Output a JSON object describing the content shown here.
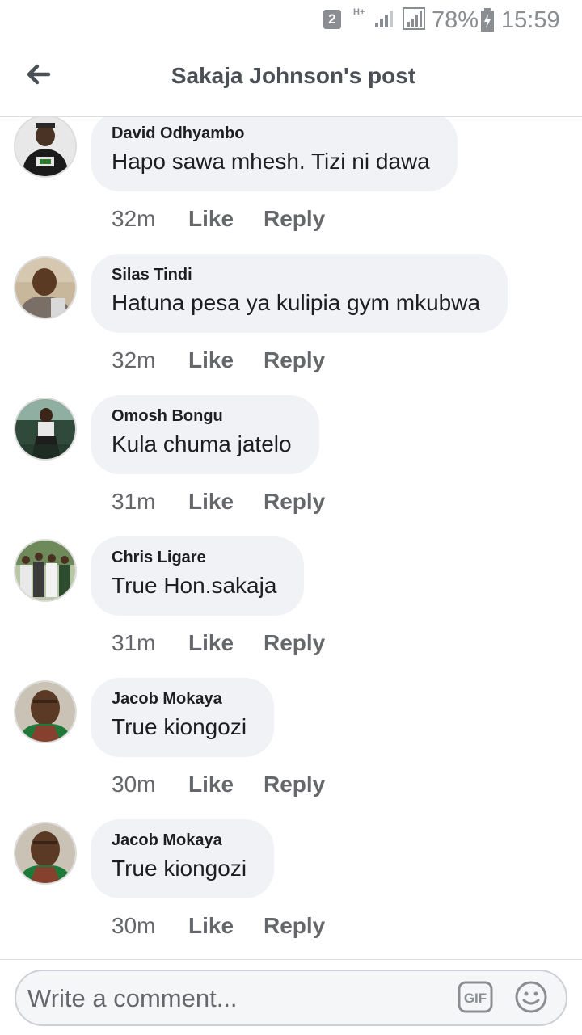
{
  "status_bar": {
    "sim": "2",
    "network": "H+",
    "battery": "78%",
    "time": "15:59"
  },
  "header": {
    "title": "Sakaja Johnson's post",
    "back_icon": "arrow-left-icon"
  },
  "comments": [
    {
      "author": "David Odhyambo",
      "text": "Hapo sawa mhesh. Tizi ni dawa",
      "time": "32m",
      "like": "Like",
      "reply": "Reply"
    },
    {
      "author": "Silas Tindi",
      "text": "Hatuna pesa ya kulipia gym mkubwa",
      "time": "32m",
      "like": "Like",
      "reply": "Reply"
    },
    {
      "author": "Omosh Bongu",
      "text": "Kula chuma jatelo",
      "time": "31m",
      "like": "Like",
      "reply": "Reply"
    },
    {
      "author": "Chris Ligare",
      "text": "True  Hon.sakaja",
      "time": "31m",
      "like": "Like",
      "reply": "Reply"
    },
    {
      "author": "Jacob Mokaya",
      "text": "True kiongozi",
      "time": "30m",
      "like": "Like",
      "reply": "Reply"
    },
    {
      "author": "Jacob Mokaya",
      "text": "True kiongozi",
      "time": "30m",
      "like": "Like",
      "reply": "Reply"
    }
  ],
  "composer": {
    "placeholder": "Write a comment...",
    "gif_label": "GIF",
    "emoji_icon": "smiley-icon"
  },
  "colors": {
    "bubble": "#f0f2f5",
    "meta_text": "#65676b",
    "divider": "#dadde1"
  }
}
